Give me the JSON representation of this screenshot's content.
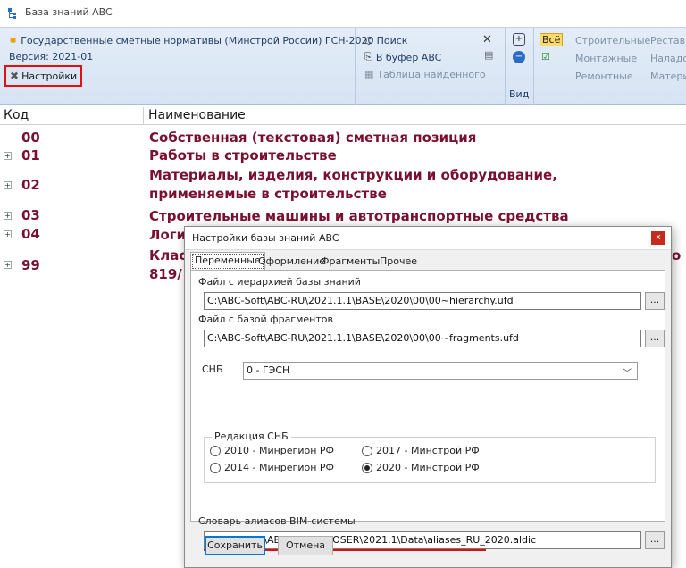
{
  "window": {
    "title": "База знаний ABC"
  },
  "ribbon": {
    "db_name": "Государственные сметные нормативы (Минстрой России) ГСН-2020",
    "version": "Версия: 2021-01",
    "settings_label": "Настройки",
    "search_label": "Поиск",
    "to_buffer_label": "В буфер ABC",
    "found_table_label": "Таблица найденного",
    "view_label": "Вид",
    "all_label": "Всё",
    "filters": [
      "Строительные",
      "Реставр",
      "Монтажные",
      "Наладо",
      "Ремонтные",
      "Матери"
    ],
    "accent": "#e01010"
  },
  "table": {
    "col_code": "Код",
    "col_name": "Наименование",
    "rows": [
      {
        "code": "00",
        "name": "Собственная (текстовая) сметная позиция"
      },
      {
        "code": "01",
        "name": "Работы в строительстве"
      },
      {
        "code": "02",
        "name": "Материалы, изделия, конструкции и оборудование,",
        "name2": "применяемые в строительстве"
      },
      {
        "code": "03",
        "name": "Строительные машины и автотранспортные средства"
      },
      {
        "code": "04",
        "name": "Логи"
      },
      {
        "code": "99",
        "name": "Клас",
        "name2": "819/",
        "tail": "о"
      }
    ],
    "row_color": "#7a1030"
  },
  "dialog": {
    "title": "Настройки базы знаний ABC",
    "close": "x",
    "tabs": [
      "Переменные",
      "Оформление",
      "Фрагменты",
      "Прочее"
    ],
    "hierarchy_label": "Файл с иерархией базы знаний",
    "hierarchy_value": "C:\\ABC-Soft\\ABC-RU\\2021.1.1\\BASE\\2020\\00\\00~hierarchy.ufd",
    "fragments_label": "Файл с базой фрагментов",
    "fragments_value": "C:\\ABC-Soft\\ABC-RU\\2021.1.1\\BASE\\2020\\00\\00~fragments.ufd",
    "browse": "...",
    "snb_label": "СНБ",
    "snb_value": "0  -  ГЭСН",
    "edition_label": "Редакция СНБ",
    "editions": [
      {
        "label": "2010 - Минрегион РФ",
        "selected": false
      },
      {
        "label": "2017 - Минстрой РФ",
        "selected": false
      },
      {
        "label": "2014 - Минрегион РФ",
        "selected": false
      },
      {
        "label": "2020 - Минстрой РФ",
        "selected": true
      }
    ],
    "bim_label": "Словарь алиасов BIM-системы",
    "bim_value": "C:\\ABC-Soft\\ABC RECOMPOSER\\2021.1\\Data\\aliases_RU_2020.aldic",
    "save": "Сохранить",
    "cancel": "Отмена"
  }
}
